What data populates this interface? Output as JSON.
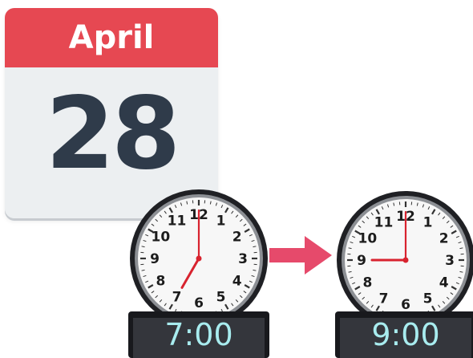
{
  "calendar": {
    "month": "April",
    "day": "28"
  },
  "clocks": {
    "start": {
      "time": "7:00",
      "hour": 7,
      "minute": 0
    },
    "end": {
      "time": "9:00",
      "hour": 9,
      "minute": 0
    }
  },
  "clock_numbers": [
    "12",
    "1",
    "2",
    "3",
    "4",
    "5",
    "6",
    "7",
    "8",
    "9",
    "10",
    "11"
  ],
  "icons": {
    "arrow": "arrow-right-icon"
  },
  "colors": {
    "calendar_header": "#e64852",
    "calendar_body": "#eceff1",
    "day_text": "#2f3b4a",
    "arrow": "#e64a6b",
    "hour_hand": "#d8232f",
    "digital_text": "#a8ecef"
  }
}
